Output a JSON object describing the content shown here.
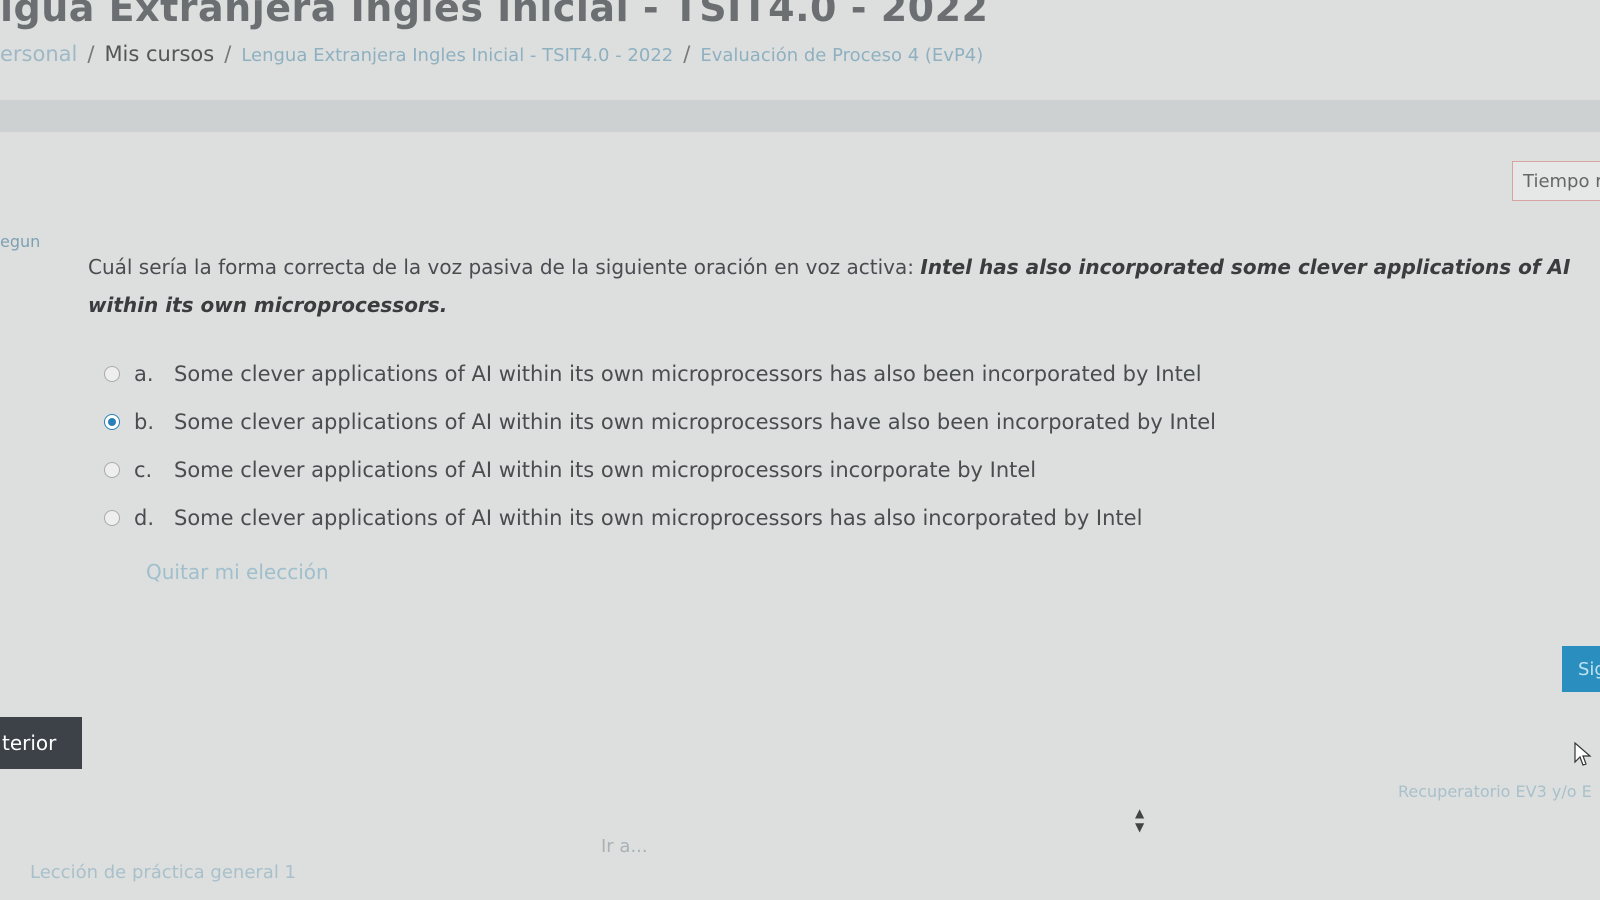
{
  "page": {
    "title": "igua Extranjera Ingles Inicial - TSIT4.0 - 2022"
  },
  "breadcrumb": {
    "items": [
      "ersonal",
      "Mis cursos",
      "Lengua Extranjera Ingles Inicial - TSIT4.0 - 2022",
      "Evaluación de Proceso 4 (EvP4)"
    ],
    "separator": "/"
  },
  "timer": {
    "label": "Tiempo r"
  },
  "question": {
    "label": "egun",
    "text_prefix": "Cuál sería la forma correcta de la voz pasiva de la siguiente oración en voz activa: ",
    "quote": "Intel has also incorporated some clever applications of AI within its own microprocessors.",
    "options": [
      {
        "letter": "a.",
        "text": "Some clever applications of AI within its own microprocessors has also been incorporated by Intel",
        "selected": false
      },
      {
        "letter": "b.",
        "text": "Some clever applications of AI within its own microprocessors have also been incorporated by Intel",
        "selected": true
      },
      {
        "letter": "c.",
        "text": "Some clever applications of AI within its own microprocessors incorporate by Intel",
        "selected": false
      },
      {
        "letter": "d.",
        "text": "Some clever applications of AI within its own microprocessors has also incorporated by Intel",
        "selected": false
      }
    ],
    "clear_choice": "Quitar mi elección"
  },
  "navigation": {
    "next_label": "Sig",
    "prev_label": "terior",
    "next_activity": "Recuperatorio EV3 y/o E",
    "jump_to": "Ir a...",
    "prev_activity": "Lección de práctica general 1"
  },
  "colors": {
    "accent": "#2a8fbf",
    "selected_radio": "#2a7fb8",
    "prev_button_bg": "#3c4248"
  }
}
